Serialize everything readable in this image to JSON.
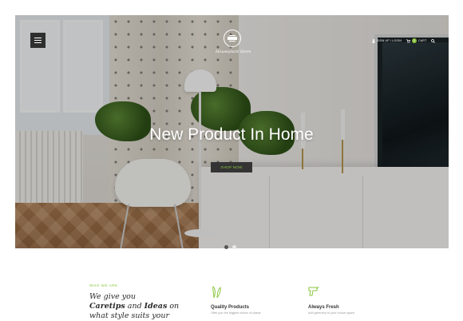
{
  "header": {
    "menu_icon": "hamburger-icon",
    "logo_tagline": "Houseplant Store",
    "nav": [
      {
        "label": "Sign up / Login",
        "icon": "user-icon"
      },
      {
        "label": "Cart",
        "icon": "cart-icon",
        "count": "0"
      },
      {
        "label": "",
        "icon": "search-icon"
      }
    ]
  },
  "hero": {
    "title": "New Product In Home",
    "button_label": "SHOP NOW",
    "dots": [
      "slide-1",
      "slide-2"
    ],
    "active_dot": 0
  },
  "intro": {
    "label": "WHO WE ARE",
    "headline_line1": "We give you",
    "headline_bold1": "Caretips",
    "headline_and": " and ",
    "headline_bold2": "Ideas",
    "headline_line2_end": " on",
    "headline_line3": "what style suits your"
  },
  "features": [
    {
      "title": "Quality Products",
      "desc": "Offer you the biggest choice of plants",
      "icon": "leaves-icon"
    },
    {
      "title": "Always Fresh",
      "desc": "Add greenery to your house space",
      "icon": "watering-can-icon"
    }
  ],
  "colors": {
    "accent": "#8cc63f",
    "button_bg": "#343434",
    "text_dark": "#2a2a2a"
  }
}
